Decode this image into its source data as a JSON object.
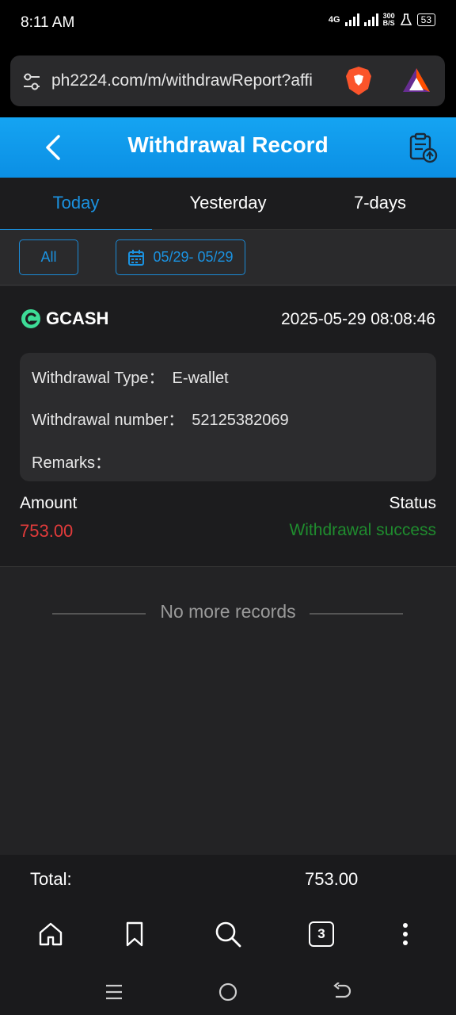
{
  "status_bar": {
    "time": "8:11 AM",
    "network": "4G",
    "speed_value": "300",
    "speed_unit": "B/S",
    "battery": "53"
  },
  "browser": {
    "url": "ph2224.com/m/withdrawReport?affi",
    "tabs_count": "3"
  },
  "header": {
    "title": "Withdrawal Record"
  },
  "tabs": [
    {
      "label": "Today",
      "active": true
    },
    {
      "label": "Yesterday",
      "active": false
    },
    {
      "label": "7-days",
      "active": false
    }
  ],
  "filters": {
    "type_label": "All",
    "date_range": "05/29- 05/29"
  },
  "record": {
    "method": "GCASH",
    "datetime": "2025-05-29 08:08:46",
    "withdrawal_type_label": "Withdrawal Type：",
    "withdrawal_type_value": "E-wallet",
    "withdrawal_number_label": "Withdrawal number：",
    "withdrawal_number_value": "52125382069",
    "remarks_label": "Remarks：",
    "remarks_value": "",
    "amount_label": "Amount",
    "amount_value": "753.00",
    "status_label": "Status",
    "status_value": "Withdrawal success"
  },
  "list_footer": "No more records",
  "total": {
    "label": "Total:",
    "value": "753.00"
  },
  "colors": {
    "accent": "#1b92e0",
    "amount": "#e23b3b",
    "success": "#1f8c2e"
  }
}
